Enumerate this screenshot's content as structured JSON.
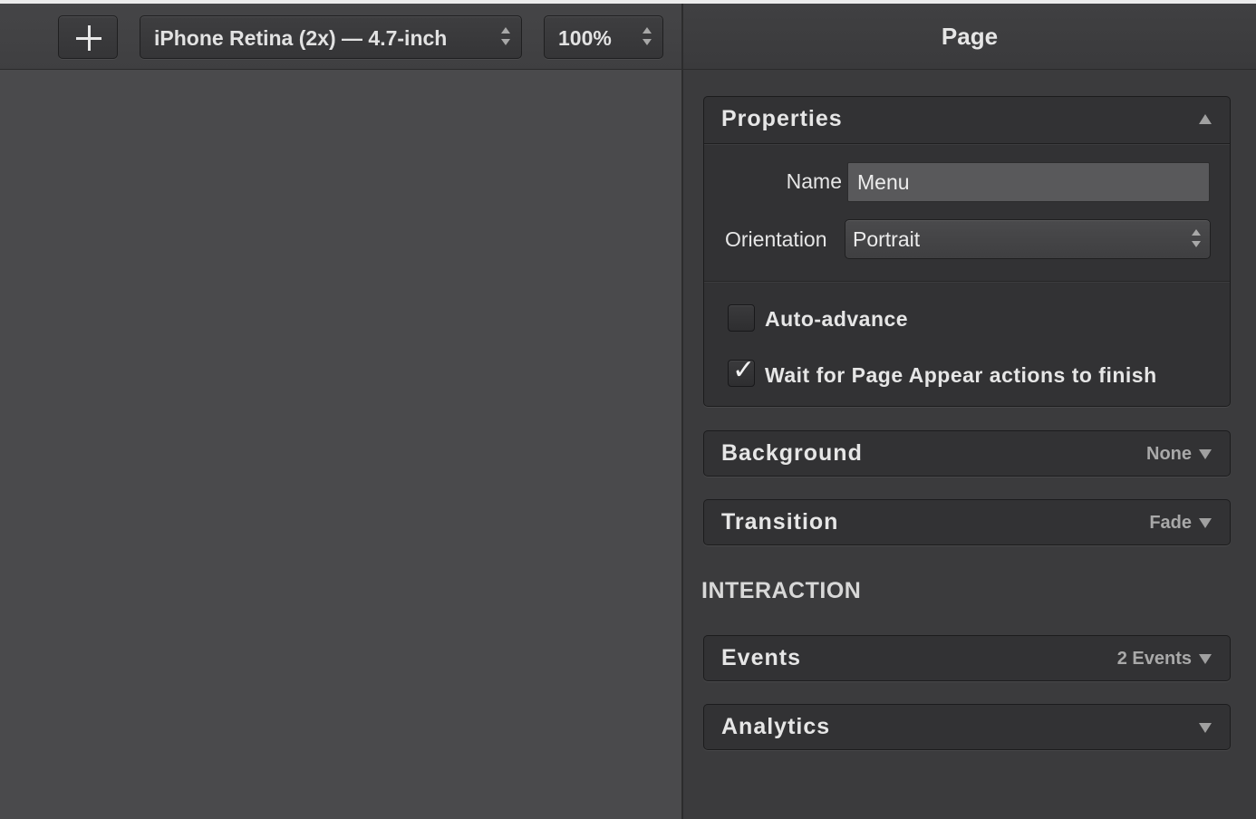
{
  "toolbar": {
    "add_icon": "plus-icon",
    "device": "iPhone Retina (2x) — 4.7-inch",
    "zoom": "100%"
  },
  "inspector": {
    "title": "Page",
    "properties": {
      "title": "Properties",
      "name_label": "Name",
      "name_value": "Menu",
      "orientation_label": "Orientation",
      "orientation_value": "Portrait",
      "auto_advance_label": "Auto-advance",
      "auto_advance_checked": false,
      "wait_label": "Wait for Page Appear actions to finish",
      "wait_checked": true
    },
    "background": {
      "title": "Background",
      "value": "None"
    },
    "transition": {
      "title": "Transition",
      "value": "Fade"
    },
    "interaction_heading": "INTERACTION",
    "events": {
      "title": "Events",
      "value": "2 Events"
    },
    "analytics": {
      "title": "Analytics"
    }
  },
  "colors": {
    "canvas": "#4a4a4c",
    "inspector": "#3b3b3d",
    "panel": "#323234"
  }
}
